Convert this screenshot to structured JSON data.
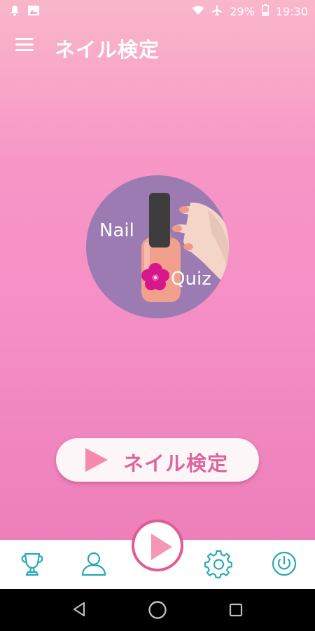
{
  "status_bar": {
    "battery": "29%",
    "time": "19:30",
    "icons": [
      "notification-bell-icon",
      "image-icon",
      "wifi-icon",
      "airplane-icon",
      "battery-icon"
    ]
  },
  "app_bar": {
    "title": "ネイル検定",
    "menu_icon": "hamburger-menu-icon"
  },
  "logo": {
    "word_top": "Nail",
    "word_bottom": "Quiz",
    "colors": {
      "circle": "#9b7bb2",
      "bottle": "#f2a08e",
      "cap": "#3d3d3d",
      "flower": "#d6168a"
    }
  },
  "start_button": {
    "label": "ネイル検定",
    "icon": "play-icon"
  },
  "bottom_nav": {
    "items": [
      "trophy-icon",
      "user-icon",
      "play-icon",
      "settings-gear-icon",
      "power-icon"
    ]
  },
  "system_nav": {
    "items": [
      "back-icon",
      "home-icon",
      "recents-icon"
    ]
  },
  "colors": {
    "accent": "#e25b93",
    "nav_icon": "#27a9b5",
    "gradient_top": "#f9b7c9",
    "gradient_bottom": "#ed7fb9"
  }
}
